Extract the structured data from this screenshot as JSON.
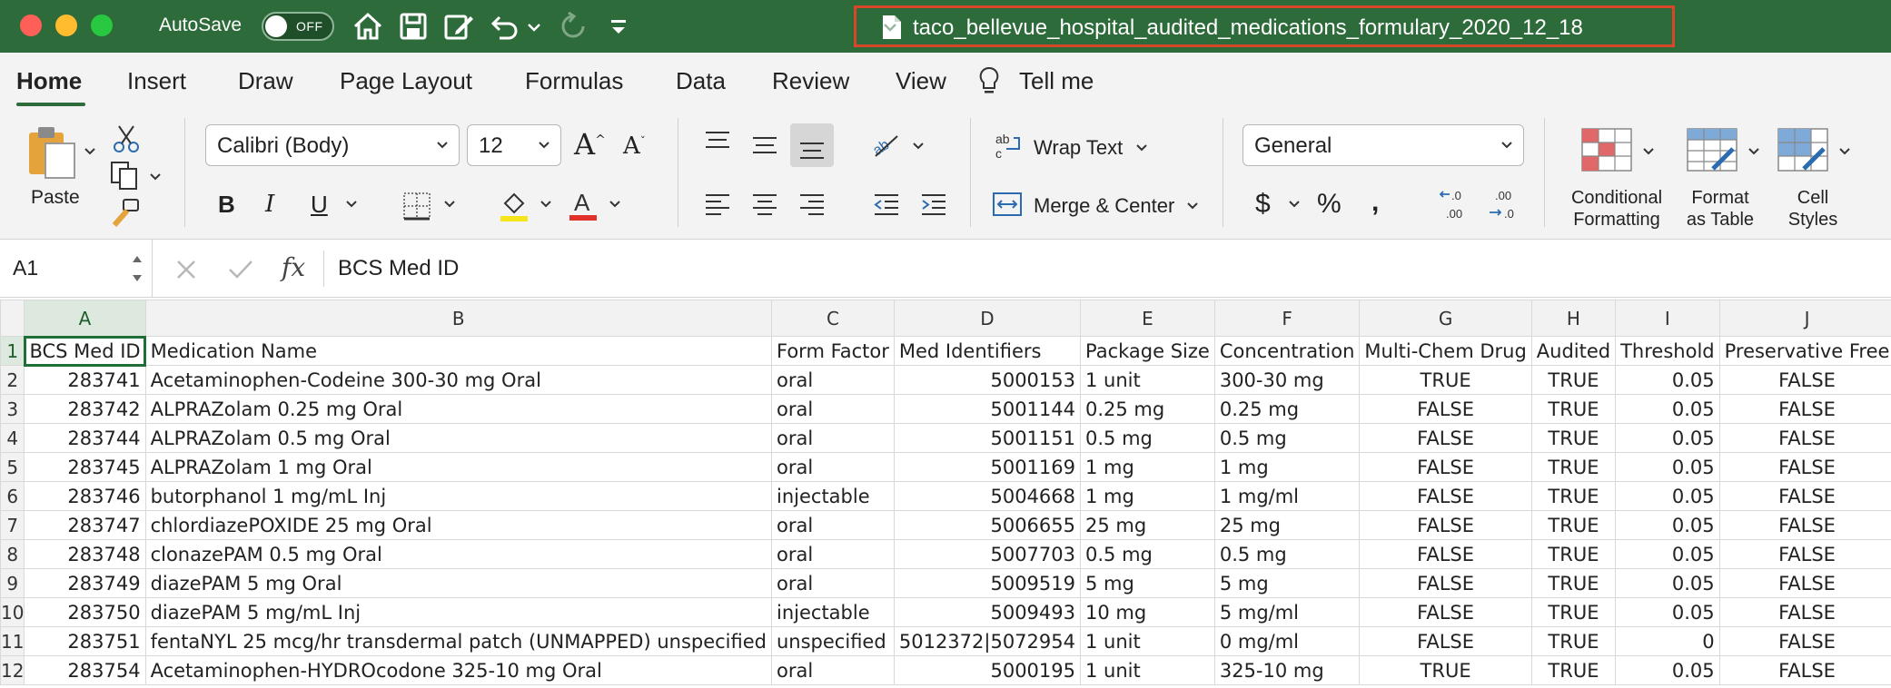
{
  "titlebar": {
    "autosave_label": "AutoSave",
    "autosave_state": "OFF",
    "document_title": "taco_bellevue_hospital_audited_medications_formulary_2020_12_18"
  },
  "menu": {
    "tabs": [
      "Home",
      "Insert",
      "Draw",
      "Page Layout",
      "Formulas",
      "Data",
      "Review",
      "View",
      "Tell me"
    ],
    "active_tab": "Home"
  },
  "ribbon": {
    "paste_label": "Paste",
    "font_name": "Calibri (Body)",
    "font_size": "12",
    "wrap_text_label": "Wrap Text",
    "merge_center_label": "Merge & Center",
    "number_format": "General",
    "conditional_formatting_label": [
      "Conditional",
      "Formatting"
    ],
    "format_as_table_label": [
      "Format",
      "as Table"
    ],
    "cell_styles_label": [
      "Cell",
      "Styles"
    ],
    "colors": {
      "font_color": "#e0312b",
      "highlight_color": "#f7e51b",
      "accent": "#2e6b3a"
    }
  },
  "formula_bar": {
    "name_box": "A1",
    "formula": "BCS Med ID"
  },
  "sheet": {
    "column_letters": [
      "A",
      "B",
      "C",
      "D",
      "E",
      "F",
      "G",
      "H",
      "I",
      "J"
    ],
    "row_numbers": [
      "1",
      "2",
      "3",
      "4",
      "5",
      "6",
      "7",
      "8",
      "9",
      "10",
      "11",
      "12"
    ],
    "headers": [
      "BCS Med ID",
      "Medication Name",
      "Form Factor",
      "Med Identifiers",
      "Package Size",
      "Concentration",
      "Multi-Chem Drug",
      "Audited",
      "Threshold",
      "Preservative Free"
    ],
    "rows": [
      [
        "283741",
        "Acetaminophen-Codeine 300-30 mg Oral",
        "oral",
        "5000153",
        "1 unit",
        "300-30 mg",
        "TRUE",
        "TRUE",
        "0.05",
        "FALSE"
      ],
      [
        "283742",
        "ALPRAZolam 0.25 mg Oral",
        "oral",
        "5001144",
        "0.25 mg",
        "0.25 mg",
        "FALSE",
        "TRUE",
        "0.05",
        "FALSE"
      ],
      [
        "283744",
        "ALPRAZolam 0.5 mg Oral",
        "oral",
        "5001151",
        "0.5 mg",
        "0.5 mg",
        "FALSE",
        "TRUE",
        "0.05",
        "FALSE"
      ],
      [
        "283745",
        "ALPRAZolam 1 mg Oral",
        "oral",
        "5001169",
        "1 mg",
        "1 mg",
        "FALSE",
        "TRUE",
        "0.05",
        "FALSE"
      ],
      [
        "283746",
        "butorphanol 1 mg/mL Inj",
        "injectable",
        "5004668",
        "1 mg",
        "1 mg/ml",
        "FALSE",
        "TRUE",
        "0.05",
        "FALSE"
      ],
      [
        "283747",
        "chlordiazePOXIDE 25 mg Oral",
        "oral",
        "5006655",
        "25 mg",
        "25 mg",
        "FALSE",
        "TRUE",
        "0.05",
        "FALSE"
      ],
      [
        "283748",
        "clonazePAM 0.5 mg Oral",
        "oral",
        "5007703",
        "0.5 mg",
        "0.5 mg",
        "FALSE",
        "TRUE",
        "0.05",
        "FALSE"
      ],
      [
        "283749",
        "diazePAM 5 mg Oral",
        "oral",
        "5009519",
        "5 mg",
        "5 mg",
        "FALSE",
        "TRUE",
        "0.05",
        "FALSE"
      ],
      [
        "283750",
        "diazePAM 5 mg/mL Inj",
        "injectable",
        "5009493",
        "10 mg",
        "5 mg/ml",
        "FALSE",
        "TRUE",
        "0.05",
        "FALSE"
      ],
      [
        "283751",
        "fentaNYL 25 mcg/hr transdermal patch (UNMAPPED) unspecified",
        "unspecified",
        "5012372|5072954",
        "1 unit",
        "0 mg/ml",
        "FALSE",
        "TRUE",
        "0",
        "FALSE"
      ],
      [
        "283754",
        "Acetaminophen-HYDROcodone 325-10 mg Oral",
        "oral",
        "5000195",
        "1 unit",
        "325-10 mg",
        "TRUE",
        "TRUE",
        "0.05",
        "FALSE"
      ]
    ]
  }
}
